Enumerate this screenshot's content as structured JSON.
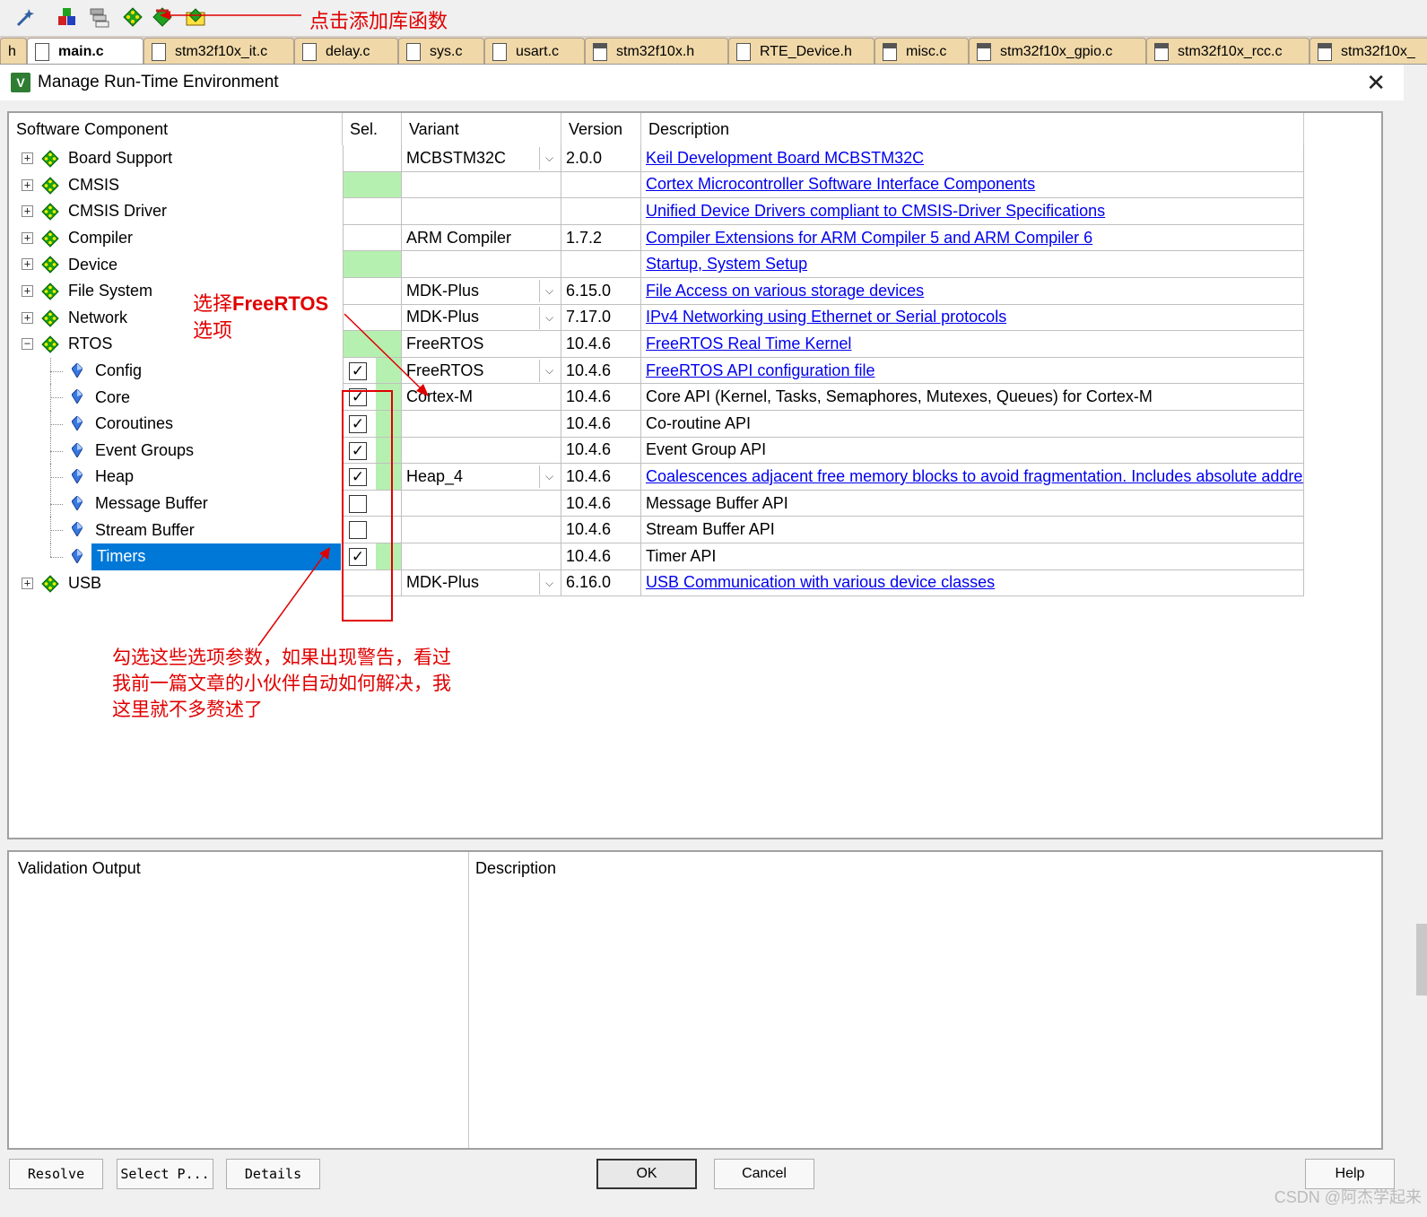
{
  "annotations": {
    "top": "点击添加库函数",
    "mid_prefix": "选择",
    "mid_bold": "FreeRTOS",
    "mid_suffix": "选项",
    "bottom": "勾选这些选项参数，如果出现警告，看过我前一篇文章的小伙伴自动如何解决，我这里就不多赘述了"
  },
  "tabs": [
    {
      "label": "h"
    },
    {
      "label": "main.c"
    },
    {
      "label": "stm32f10x_it.c"
    },
    {
      "label": "delay.c"
    },
    {
      "label": "sys.c"
    },
    {
      "label": "usart.c"
    },
    {
      "label": "stm32f10x.h"
    },
    {
      "label": "RTE_Device.h"
    },
    {
      "label": "misc.c"
    },
    {
      "label": "stm32f10x_gpio.c"
    },
    {
      "label": "stm32f10x_rcc.c"
    },
    {
      "label": "stm32f10x_"
    }
  ],
  "dialog": {
    "title": "Manage Run-Time Environment",
    "app_icon": "V",
    "close": "✕"
  },
  "headers": {
    "component": "Software Component",
    "sel": "Sel.",
    "variant": "Variant",
    "version": "Version",
    "description": "Description"
  },
  "rows": [
    {
      "name": "Board Support",
      "level": 0,
      "expander": "+",
      "sel": "",
      "variant": "MCBSTM32C",
      "dropdown": true,
      "version": "2.0.0",
      "desc": "Keil Development Board MCBSTM32C",
      "link": true
    },
    {
      "name": "CMSIS",
      "level": 0,
      "expander": "+",
      "sel": "green",
      "variant": "",
      "dropdown": false,
      "version": "",
      "desc": "Cortex Microcontroller Software Interface Components",
      "link": true
    },
    {
      "name": "CMSIS Driver",
      "level": 0,
      "expander": "+",
      "sel": "",
      "variant": "",
      "dropdown": false,
      "version": "",
      "desc": "Unified Device Drivers compliant to CMSIS-Driver Specifications",
      "link": true
    },
    {
      "name": "Compiler",
      "level": 0,
      "expander": "+",
      "sel": "",
      "variant": "ARM Compiler",
      "dropdown": false,
      "version": "1.7.2",
      "desc": "Compiler Extensions for ARM Compiler 5 and ARM Compiler 6",
      "link": true
    },
    {
      "name": "Device",
      "level": 0,
      "expander": "+",
      "sel": "green",
      "variant": "",
      "dropdown": false,
      "version": "",
      "desc": "Startup, System Setup",
      "link": true
    },
    {
      "name": "File System",
      "level": 0,
      "expander": "+",
      "sel": "",
      "variant": "MDK-Plus",
      "dropdown": true,
      "version": "6.15.0",
      "desc": "File Access on various storage devices",
      "link": true
    },
    {
      "name": "Network",
      "level": 0,
      "expander": "+",
      "sel": "",
      "variant": "MDK-Plus",
      "dropdown": true,
      "version": "7.17.0",
      "desc": "IPv4 Networking using Ethernet or Serial protocols",
      "link": true
    },
    {
      "name": "RTOS",
      "level": 0,
      "expander": "−",
      "sel": "green",
      "variant": "FreeRTOS",
      "dropdown": false,
      "version": "10.4.6",
      "desc": "FreeRTOS Real Time Kernel",
      "link": true
    },
    {
      "name": "Config",
      "level": 1,
      "sel": "checked",
      "variant": "FreeRTOS",
      "dropdown": true,
      "version": "10.4.6",
      "desc": "FreeRTOS API configuration file",
      "link": true
    },
    {
      "name": "Core",
      "level": 1,
      "sel": "checked",
      "variant": "Cortex-M",
      "dropdown": false,
      "version": "10.4.6",
      "desc": "Core API (Kernel, Tasks, Semaphores, Mutexes, Queues) for Cortex-M",
      "link": false
    },
    {
      "name": "Coroutines",
      "level": 1,
      "sel": "checked",
      "variant": "",
      "dropdown": false,
      "version": "10.4.6",
      "desc": "Co-routine API",
      "link": false
    },
    {
      "name": "Event Groups",
      "level": 1,
      "sel": "checked",
      "variant": "",
      "dropdown": false,
      "version": "10.4.6",
      "desc": "Event Group API",
      "link": false
    },
    {
      "name": "Heap",
      "level": 1,
      "sel": "checked",
      "variant": "Heap_4",
      "dropdown": true,
      "version": "10.4.6",
      "desc": "Coalescences adjacent free memory blocks to avoid fragmentation. Includes absolute addres...",
      "link": true
    },
    {
      "name": "Message Buffer",
      "level": 1,
      "sel": "unchecked",
      "variant": "",
      "dropdown": false,
      "version": "10.4.6",
      "desc": "Message Buffer API",
      "link": false
    },
    {
      "name": "Stream Buffer",
      "level": 1,
      "sel": "unchecked",
      "variant": "",
      "dropdown": false,
      "version": "10.4.6",
      "desc": "Stream Buffer API",
      "link": false
    },
    {
      "name": "Timers",
      "level": 1,
      "sel": "checked",
      "variant": "",
      "dropdown": false,
      "version": "10.4.6",
      "desc": "Timer API",
      "link": false,
      "selected": true
    },
    {
      "name": "USB",
      "level": 0,
      "expander": "+",
      "sel": "",
      "variant": "MDK-Plus",
      "dropdown": true,
      "version": "6.16.0",
      "desc": "USB Communication with various device classes",
      "link": true
    }
  ],
  "validation": {
    "output_label": "Validation Output",
    "description_label": "Description"
  },
  "buttons": {
    "resolve": "Resolve",
    "select": "Select P...",
    "details": "Details",
    "ok": "OK",
    "cancel": "Cancel",
    "help": "Help"
  },
  "watermark": "CSDN @阿杰学起来",
  "colors": {
    "selected_row": "#0078d7",
    "sel_green": "#b6f0b0",
    "link": "#0000ee",
    "annotation_red": "#e00000"
  }
}
